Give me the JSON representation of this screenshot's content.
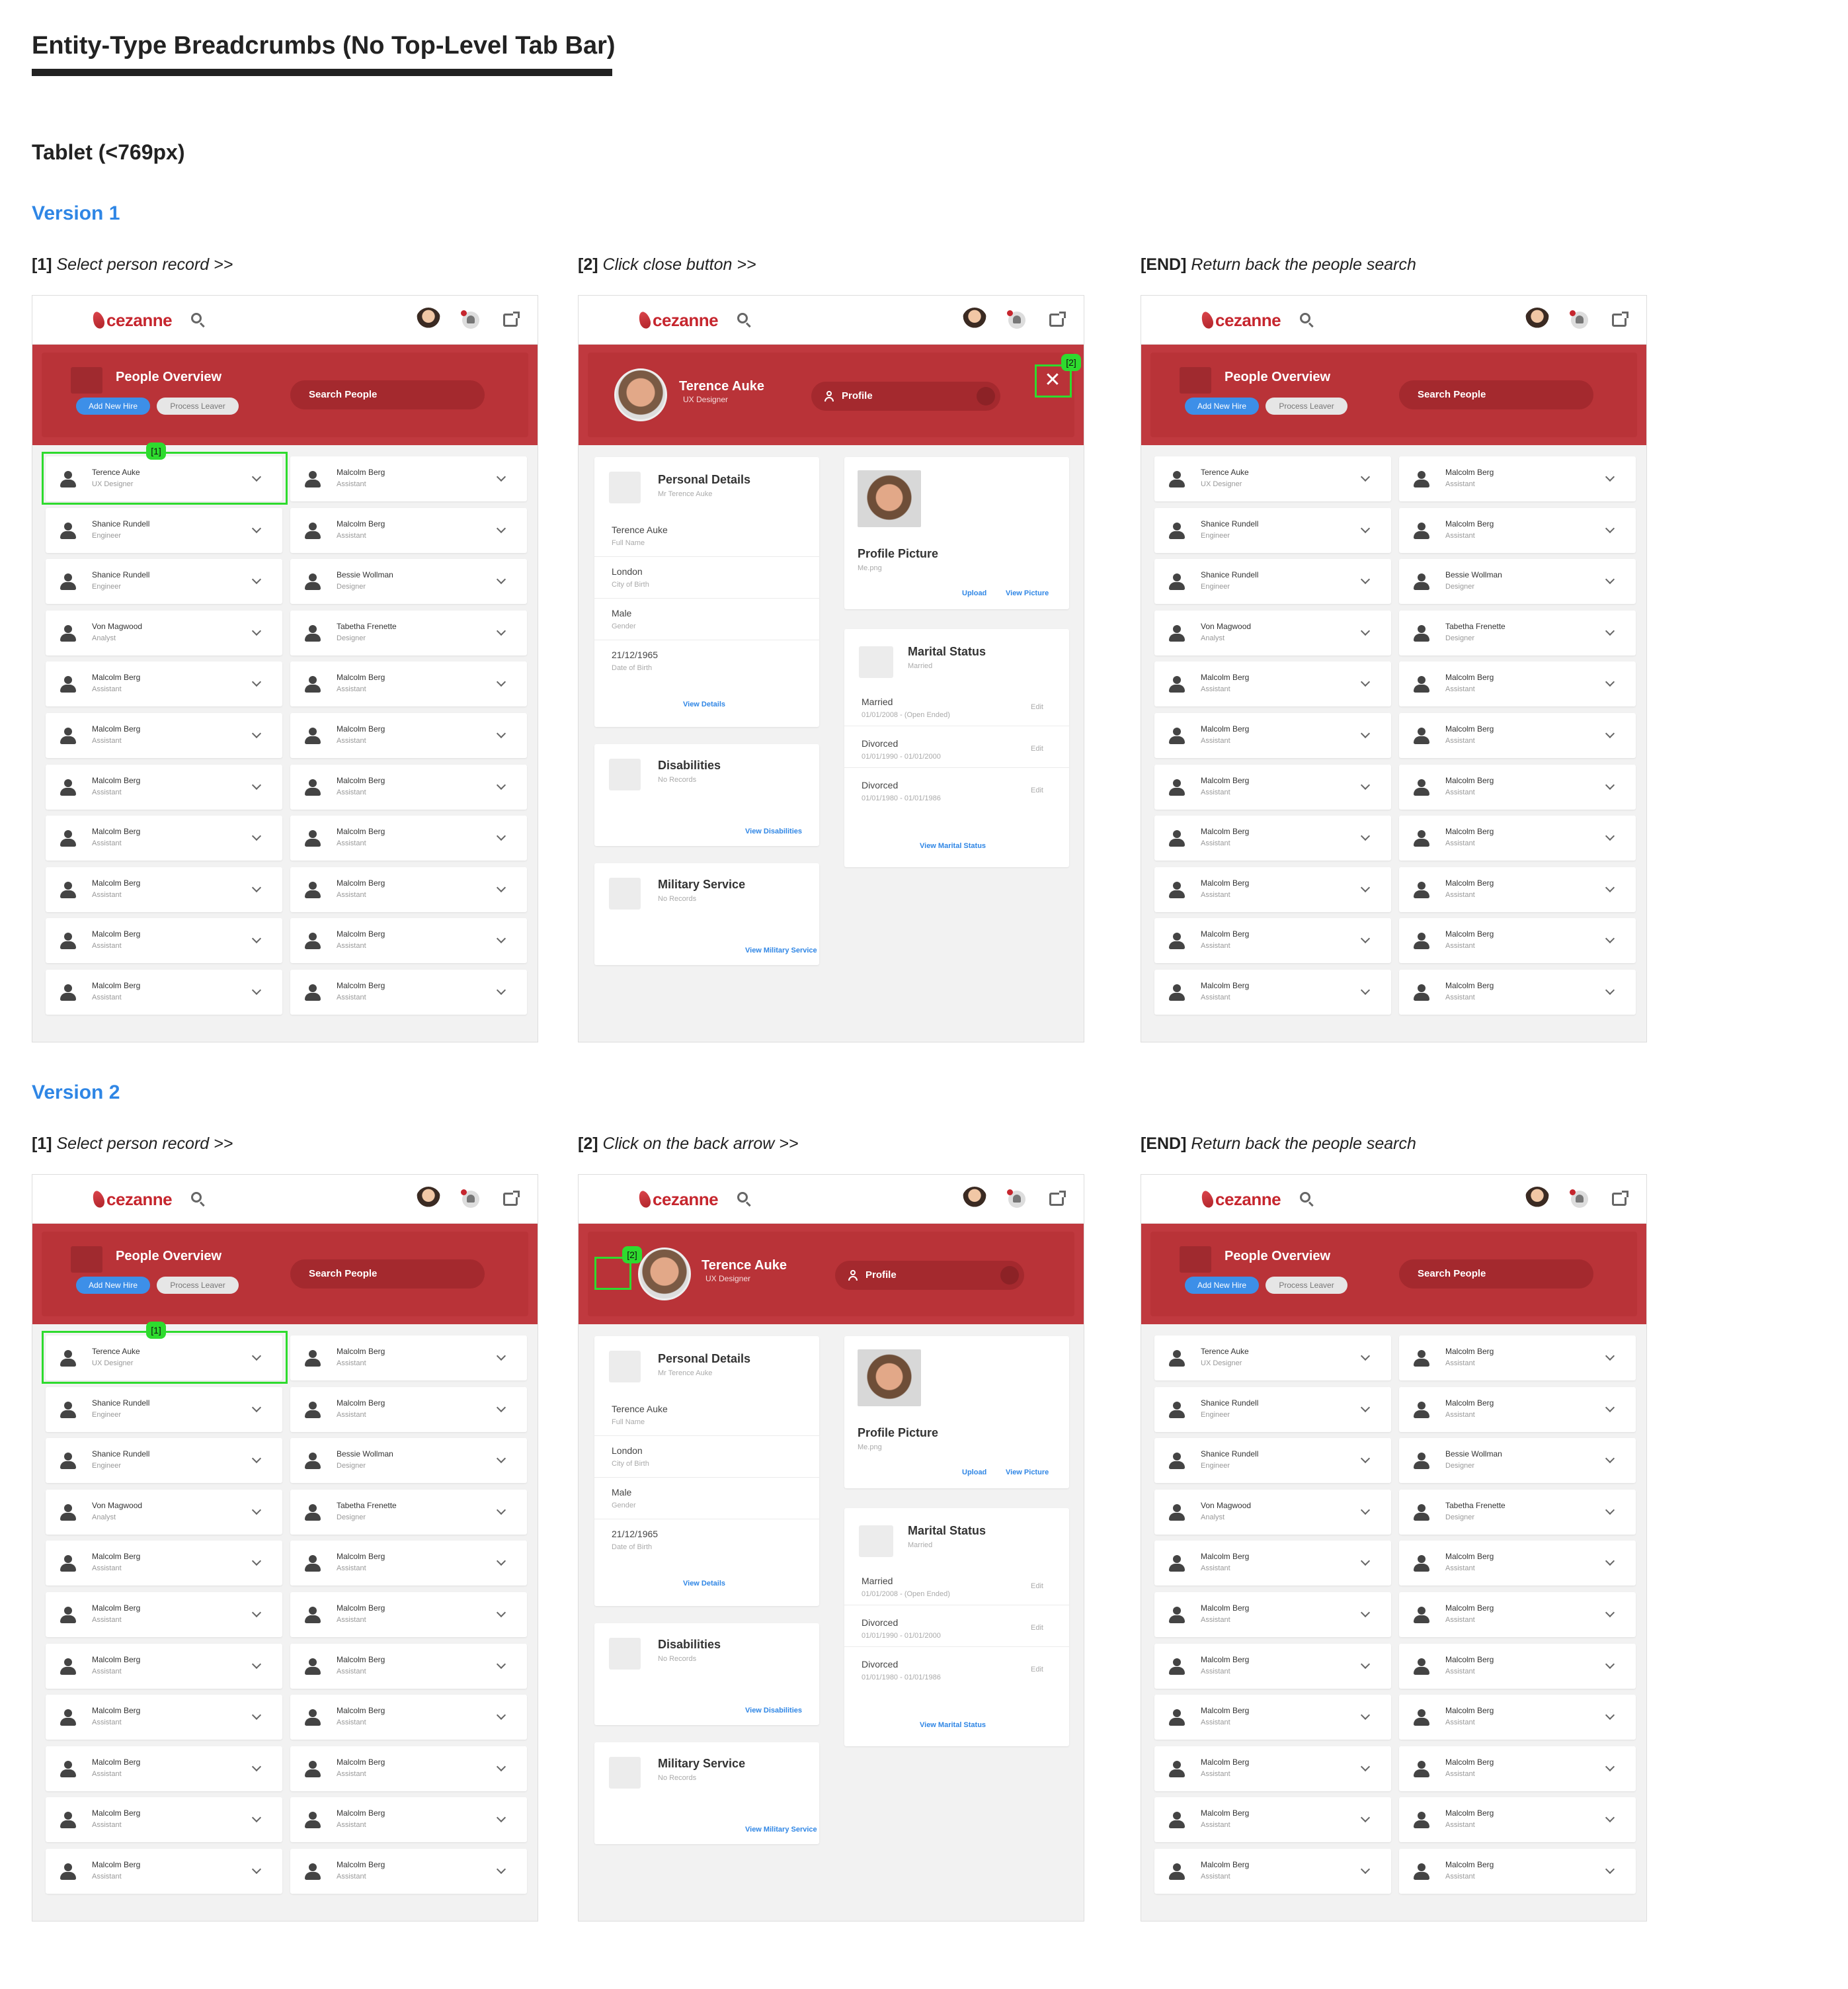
{
  "page": {
    "title": "Entity-Type Breadcrumbs (No Top-Level Tab Bar)",
    "section": "Tablet (<769px)"
  },
  "versions": [
    {
      "heading": "Version 1",
      "steps": [
        {
          "tag": "[1]",
          "text": "Select person record >>"
        },
        {
          "tag": "[2]",
          "text": "Click close button  >>"
        },
        {
          "tag": "[END]",
          "text": "Return back the people search"
        }
      ]
    },
    {
      "heading": "Version 2",
      "steps": [
        {
          "tag": "[1]",
          "text": "Select person record >>"
        },
        {
          "tag": "[2]",
          "text": "Click on the back arrow  >>"
        },
        {
          "tag": "[END]",
          "text": "Return back the people search"
        }
      ]
    }
  ],
  "app": {
    "logo": "cezanne",
    "people_overview": "People Overview",
    "add_new_hire": "Add New Hire",
    "process_leaver": "Process Leaver",
    "search_people": "Search People",
    "badge_1": "[1]",
    "badge_2": "[2]",
    "close_glyph": "✕"
  },
  "people": [
    [
      {
        "name": "Terence Auke",
        "role": "UX Designer"
      },
      {
        "name": "Malcolm Berg",
        "role": "Assistant"
      }
    ],
    [
      {
        "name": "Shanice Rundell",
        "role": "Engineer"
      },
      {
        "name": "Malcolm Berg",
        "role": "Assistant"
      }
    ],
    [
      {
        "name": "Shanice Rundell",
        "role": "Engineer"
      },
      {
        "name": "Bessie Wollman",
        "role": "Designer"
      }
    ],
    [
      {
        "name": "Von Magwood",
        "role": "Analyst"
      },
      {
        "name": "Tabetha Frenette",
        "role": "Designer"
      }
    ],
    [
      {
        "name": "Malcolm Berg",
        "role": "Assistant"
      },
      {
        "name": "Malcolm Berg",
        "role": "Assistant"
      }
    ],
    [
      {
        "name": "Malcolm Berg",
        "role": "Assistant"
      },
      {
        "name": "Malcolm Berg",
        "role": "Assistant"
      }
    ],
    [
      {
        "name": "Malcolm Berg",
        "role": "Assistant"
      },
      {
        "name": "Malcolm Berg",
        "role": "Assistant"
      }
    ],
    [
      {
        "name": "Malcolm Berg",
        "role": "Assistant"
      },
      {
        "name": "Malcolm Berg",
        "role": "Assistant"
      }
    ],
    [
      {
        "name": "Malcolm Berg",
        "role": "Assistant"
      },
      {
        "name": "Malcolm Berg",
        "role": "Assistant"
      }
    ],
    [
      {
        "name": "Malcolm Berg",
        "role": "Assistant"
      },
      {
        "name": "Malcolm Berg",
        "role": "Assistant"
      }
    ],
    [
      {
        "name": "Malcolm Berg",
        "role": "Assistant"
      },
      {
        "name": "Malcolm Berg",
        "role": "Assistant"
      }
    ]
  ],
  "detail": {
    "name": "Terence Auke",
    "role": "UX Designer",
    "profile_select": "Profile",
    "personal": {
      "title": "Personal Details",
      "sub": "Mr Terence Auke",
      "fields": [
        {
          "value": "Terence Auke",
          "label": "Full Name"
        },
        {
          "value": "London",
          "label": "City of Birth"
        },
        {
          "value": "Male",
          "label": "Gender"
        },
        {
          "value": "21/12/1965",
          "label": "Date of Birth"
        }
      ],
      "link": "View Details"
    },
    "picture": {
      "title": "Profile Picture",
      "file": "Me.png",
      "upload": "Upload",
      "view": "View Picture"
    },
    "disabilities": {
      "title": "Disabilities",
      "sub": "No Records",
      "link": "View Disabilities"
    },
    "military": {
      "title": "Military Service",
      "sub": "No Records",
      "link": "View Military Service"
    },
    "marital": {
      "title": "Marital Status",
      "sub": "Married",
      "entries": [
        {
          "status": "Married",
          "dates": "01/01/2008 - (Open Ended)",
          "edit": "Edit"
        },
        {
          "status": "Divorced",
          "dates": "01/01/1990 - 01/01/2000",
          "edit": "Edit"
        },
        {
          "status": "Divorced",
          "dates": "01/01/1980 - 01/01/1986",
          "edit": "Edit"
        }
      ],
      "link": "View Marital Status"
    }
  },
  "colors": {
    "brand_red": "#c0393f",
    "link_blue": "#2f86e5",
    "highlight_green": "#2edb2e"
  }
}
